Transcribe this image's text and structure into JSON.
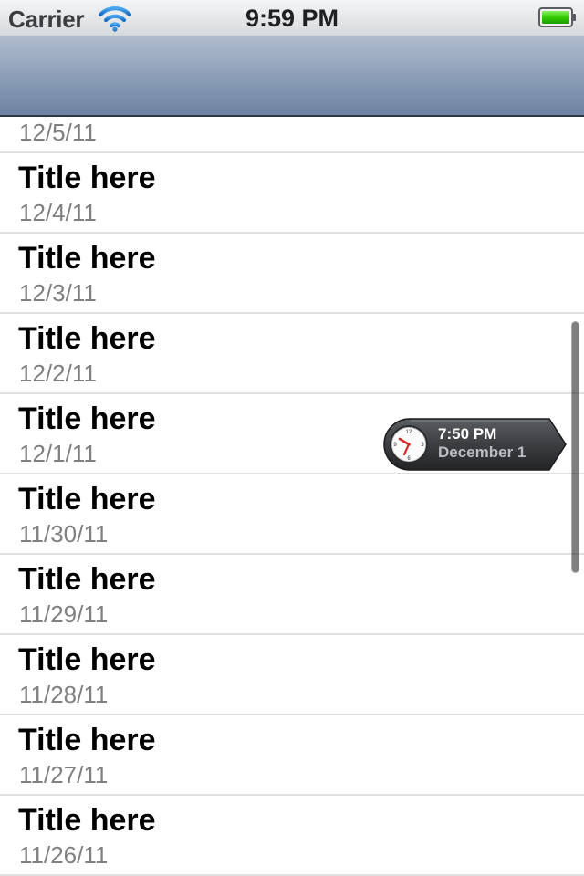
{
  "status_bar": {
    "carrier": "Carrier",
    "time": "9:59 PM",
    "wifi_icon": "wifi-icon",
    "battery_icon": "battery-icon",
    "battery_color": "#33cc00"
  },
  "nav_bar": {
    "title": ""
  },
  "list": {
    "rows": [
      {
        "title": "Title here",
        "date": "12/5/11"
      },
      {
        "title": "Title here",
        "date": "12/4/11"
      },
      {
        "title": "Title here",
        "date": "12/3/11"
      },
      {
        "title": "Title here",
        "date": "12/2/11"
      },
      {
        "title": "Title here",
        "date": "12/1/11"
      },
      {
        "title": "Title here",
        "date": "11/30/11"
      },
      {
        "title": "Title here",
        "date": "11/29/11"
      },
      {
        "title": "Title here",
        "date": "11/28/11"
      },
      {
        "title": "Title here",
        "date": "11/27/11"
      },
      {
        "title": "Title here",
        "date": "11/26/11"
      }
    ]
  },
  "time_scroller": {
    "time": "7:50 PM",
    "date": "December 1",
    "icon": "clock-icon"
  },
  "colors": {
    "nav_top": "#b0bccd",
    "nav_bottom": "#6d84a2",
    "separator": "#e0e0e0",
    "date_text": "#808080"
  }
}
